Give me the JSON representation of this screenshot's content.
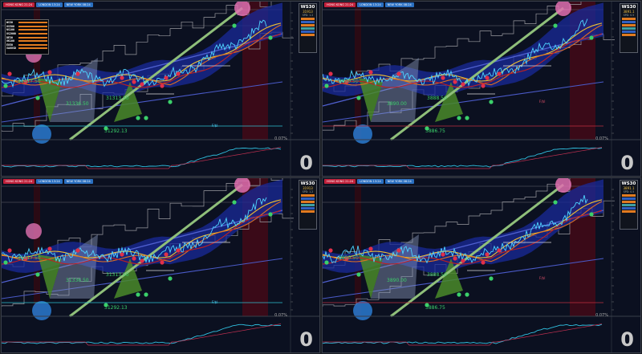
{
  "sessions": [
    {
      "label": "HONG KONG 21:24",
      "color": "#c0203a"
    },
    {
      "label": "LONDON 13:24",
      "color": "#2a6fc0"
    },
    {
      "label": "NEW YORK 08:24",
      "color": "#2a6fc0"
    }
  ],
  "panels": [
    {
      "id": "panel-top-left",
      "symbol": "WS30",
      "price": "31913",
      "spread": "SPD: 1.2",
      "zero_label": "0",
      "percent_label": "0.07%",
      "fvtk_label": "F/$I",
      "levels": [
        "31417.50",
        "31336.50",
        "31313.50",
        "31292.13"
      ],
      "show_table": true,
      "table_rows": [
        "WS30",
        "US500",
        "NS100",
        "US2000",
        "DE30",
        "UK100",
        "EU50",
        "XAUUSD"
      ]
    },
    {
      "id": "panel-top-right",
      "symbol": "WS30",
      "price": "3891.1",
      "spread": "SPD: 0.5",
      "zero_label": "0",
      "percent_label": "0.07%",
      "fvtk_label": "F/$I",
      "levels": [
        "3890.50",
        "3890.00",
        "3888.50",
        "3886.75"
      ],
      "show_table": false,
      "table_rows": []
    },
    {
      "id": "panel-bottom-left",
      "symbol": "WS30",
      "price": "31913",
      "spread": "SPD: 1.2",
      "zero_label": "0",
      "percent_label": "0.07%",
      "fvtk_label": "F/$I",
      "levels": [
        "31417.50",
        "31336.50",
        "31313.50",
        "31292.13"
      ],
      "show_table": false,
      "table_rows": []
    },
    {
      "id": "panel-bottom-right",
      "symbol": "WS30",
      "price": "3891.1",
      "spread": "SPD: 0.5",
      "zero_label": "0",
      "percent_label": "0.07%",
      "fvtk_label": "F/$I",
      "levels": [
        "3890.50",
        "3890.00",
        "3888.50",
        "3886.75"
      ],
      "show_table": false,
      "table_rows": []
    }
  ],
  "colors": {
    "background": "#0b1020",
    "cloud": "#1a2a9a",
    "trendline": "#8fbf7a",
    "price": "#4fd4ff",
    "ma_yellow": "#f0c030",
    "ma_orange": "#e07020",
    "pivot_high": "#e0304a",
    "pivot_low": "#3bd06a",
    "session_shade": "#3a0a18",
    "channel": "#9a9aa0"
  }
}
